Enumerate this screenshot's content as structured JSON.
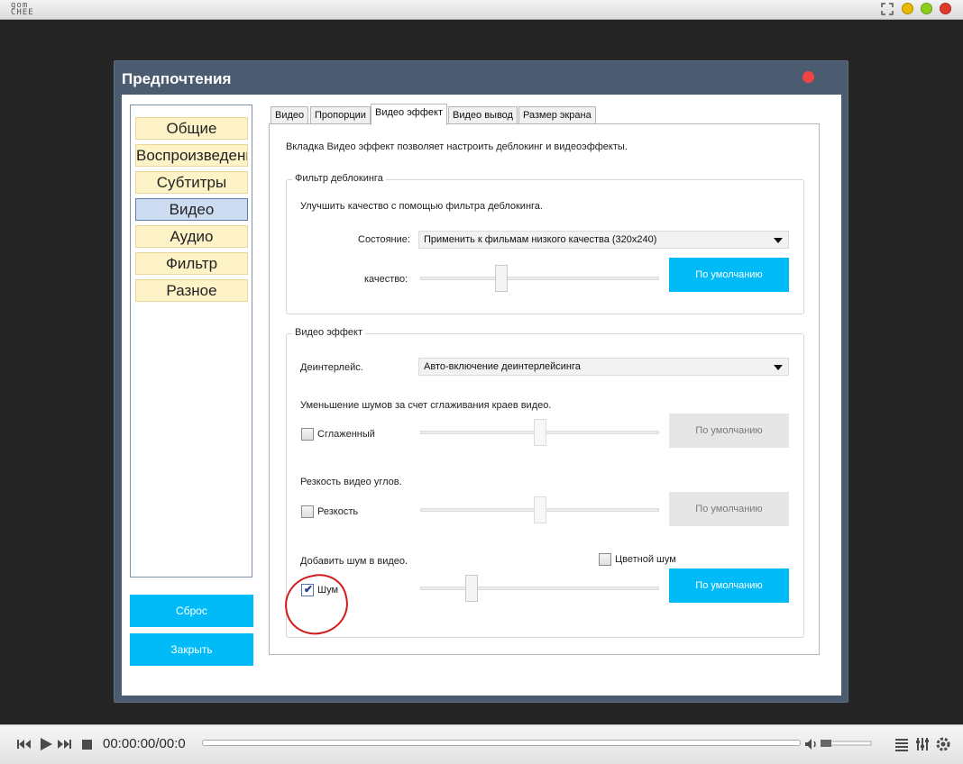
{
  "titlebar": {
    "logo_line1": "gom",
    "logo_line2": "CHEE",
    "buttons": [
      {
        "name": "minimize",
        "color": "#e9b800"
      },
      {
        "name": "maximize",
        "color": "#8ccf1a"
      },
      {
        "name": "close",
        "color": "#e23a2a"
      }
    ]
  },
  "dialog": {
    "title": "Предпочтения",
    "nav": [
      {
        "label": "Общие",
        "active": false
      },
      {
        "label": "Воспроизведение",
        "active": false
      },
      {
        "label": "Субтитры",
        "active": false
      },
      {
        "label": "Видео",
        "active": true
      },
      {
        "label": "Аудио",
        "active": false
      },
      {
        "label": "Фильтр",
        "active": false
      },
      {
        "label": "Разное",
        "active": false
      }
    ],
    "reset_label": "Сброс",
    "close_label": "Закрыть",
    "tabs": [
      "Видео",
      "Пропорции",
      "Видео эффект",
      "Видео вывод",
      "Размер экрана"
    ],
    "active_tab": "Видео эффект",
    "description": "Вкладка Видео эффект позволяет настроить деблокинг и видеоэффекты.",
    "deblock_group": {
      "legend": "Фильтр деблокинга",
      "hint": "Улучшить качество с помощью фильтра деблокинга.",
      "state_label": "Состояние:",
      "state_value": "Применить к фильмам низкого качества (320x240)",
      "quality_label": "качество:",
      "quality_level": 0.33,
      "default_label": "По умолчанию"
    },
    "effect_group": {
      "legend": "Видео эффект",
      "deinterlace_label": "Деинтерлейс.",
      "deinterlace_value": "Авто-включение деинтерлейсинга",
      "smooth_hint": "Уменьшение шумов за счет сглаживания краев видео.",
      "smooth_label": "Сглаженный",
      "smooth_checked": false,
      "smooth_level": 0.5,
      "sharp_hint": "Резкость видео углов.",
      "sharp_label": "Резкость",
      "sharp_checked": false,
      "sharp_level": 0.5,
      "noise_hint": "Добавить шум в видео.",
      "color_noise_label": "Цветной шум",
      "color_noise_checked": false,
      "noise_label": "Шум",
      "noise_checked": true,
      "noise_level": 0.2,
      "default_label": "По умолчанию"
    }
  },
  "player": {
    "time": "00:00:00/00:0",
    "accent": "#00bbf7"
  }
}
